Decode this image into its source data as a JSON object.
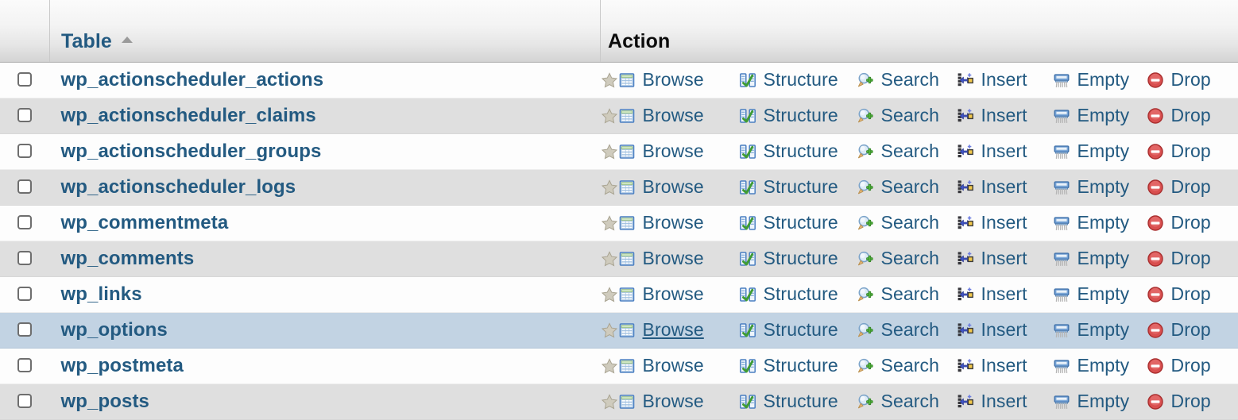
{
  "table_header": {
    "checkbox_column": "",
    "name_column_label": "Table",
    "name_column_sort": "ascending",
    "action_column_label": "Action"
  },
  "actions": {
    "favorite": {
      "label": "",
      "icon": "star-icon"
    },
    "browse": {
      "label": "Browse",
      "icon": "browse-table-icon"
    },
    "structure": {
      "label": "Structure",
      "icon": "structure-icon"
    },
    "search": {
      "label": "Search",
      "icon": "search-icon"
    },
    "insert": {
      "label": "Insert",
      "icon": "insert-row-icon"
    },
    "empty": {
      "label": "Empty",
      "icon": "empty-broom-icon"
    },
    "drop": {
      "label": "Drop",
      "icon": "drop-delete-icon"
    }
  },
  "rows": [
    {
      "name": "wp_actionscheduler_actions",
      "shade": "odd",
      "checked": false,
      "hovered_action": ""
    },
    {
      "name": "wp_actionscheduler_claims",
      "shade": "even",
      "checked": false,
      "hovered_action": ""
    },
    {
      "name": "wp_actionscheduler_groups",
      "shade": "odd",
      "checked": false,
      "hovered_action": ""
    },
    {
      "name": "wp_actionscheduler_logs",
      "shade": "even",
      "checked": false,
      "hovered_action": ""
    },
    {
      "name": "wp_commentmeta",
      "shade": "odd",
      "checked": false,
      "hovered_action": ""
    },
    {
      "name": "wp_comments",
      "shade": "even",
      "checked": false,
      "hovered_action": ""
    },
    {
      "name": "wp_links",
      "shade": "odd",
      "checked": false,
      "hovered_action": ""
    },
    {
      "name": "wp_options",
      "shade": "marked",
      "checked": false,
      "hovered_action": "browse"
    },
    {
      "name": "wp_postmeta",
      "shade": "odd",
      "checked": false,
      "hovered_action": ""
    },
    {
      "name": "wp_posts",
      "shade": "even",
      "checked": false,
      "hovered_action": ""
    }
  ],
  "colors": {
    "link": "#235a81",
    "row_odd": "#fdfdfd",
    "row_even": "#dfdfdf",
    "row_marked": "#c2d3e3",
    "header_text": "#0c0c0c",
    "drop_red": "#d94f4f",
    "browse_blue": "#6f9ed6",
    "structure_green": "#4b9e3f"
  }
}
